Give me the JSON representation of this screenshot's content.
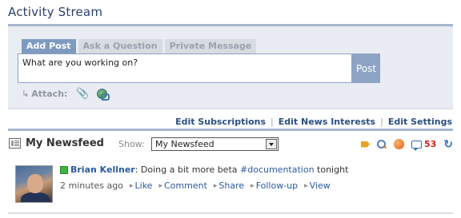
{
  "header": {
    "title": "Activity Stream"
  },
  "composer": {
    "tabs": [
      {
        "label": "Add Post",
        "active": true
      },
      {
        "label": "Ask a Question",
        "active": false
      },
      {
        "label": "Private Message",
        "active": false
      }
    ],
    "input_value": "What are you working on?",
    "post_button": "Post",
    "attach_label": "Attach:"
  },
  "links": {
    "edit_subscriptions": "Edit Subscriptions",
    "edit_news_interests": "Edit News Interests",
    "edit_settings": "Edit Settings",
    "separator": "|"
  },
  "feed": {
    "title": "My Newsfeed",
    "show_label": "Show:",
    "selected_filter": "My Newsfeed",
    "comment_count": "53",
    "items": [
      {
        "author": "Brian Kellner",
        "text_before": ": Doing a bit more beta ",
        "hashtag": "#documentation",
        "text_after": " tonight",
        "time": "2 minutes ago",
        "actions": [
          "Like",
          "Comment",
          "Share",
          "Follow-up",
          "View"
        ]
      }
    ]
  },
  "colors": {
    "title": "#2a3f6a",
    "rule": "#a6b6cc",
    "active_tab": "#7f9abf",
    "link": "#2a4f80",
    "count": "#d02020",
    "status": "#3db340"
  },
  "icons": [
    "document-list-icon",
    "tag-icon",
    "search-icon",
    "rss-icon",
    "comment-icon",
    "refresh-icon",
    "paperclip-icon",
    "link-icon",
    "status-icon"
  ]
}
